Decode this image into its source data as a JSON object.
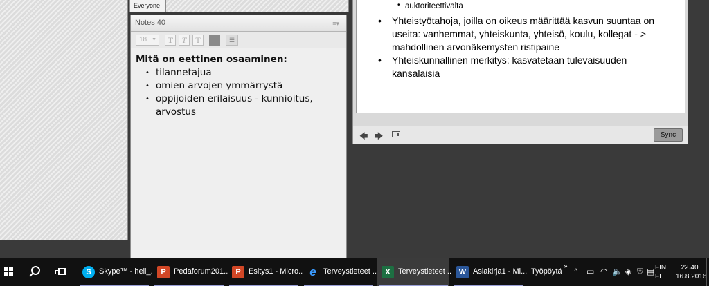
{
  "left_panel": {},
  "attendee_strip": {
    "tab_label": "Everyone"
  },
  "notes_pod": {
    "title": "Notes 40",
    "menu_icon": "≡▾",
    "toolbar": {
      "font_size": "18",
      "bold": "T",
      "italic": "T",
      "underline": "T",
      "list": "☰"
    },
    "heading": "Mitä on eettinen osaaminen:",
    "items": [
      "tilannetajua",
      "omien arvojen ymmärrystä",
      "oppijoiden erilaisuus - kunnioitus, arvostus"
    ]
  },
  "share_pod": {
    "sub_bullet": "auktoriteettivalta",
    "bullets": [
      "Yhteistyötahoja, joilla on oikeus määrittää kasvun suuntaa on useita:  vanhemmat, yhteiskunta, yhteisö, koulu, kollegat - > mahdollinen arvonäkemysten ristipaine",
      "Yhteiskunnallinen merkitys: kasvatetaan tulevaisuuden kansalaisia"
    ],
    "prev": "🡄",
    "next": "🡆",
    "sync_label": "Sync"
  },
  "taskbar": {
    "apps": [
      {
        "label": "Skype™ - heli_...",
        "icon": "S",
        "color": "#00aff0"
      },
      {
        "label": "Pedaforum201...",
        "icon": "P",
        "color": "#d24726"
      },
      {
        "label": "Esitys1 - Micro...",
        "icon": "P",
        "color": "#d24726"
      },
      {
        "label": "Terveystieteet ...",
        "icon": "e",
        "color": "#1e90ff"
      },
      {
        "label": "Terveystieteet ...",
        "icon": "X",
        "color": "#1d6f42"
      },
      {
        "label": "Asiakirja1 - Mi...",
        "icon": "W",
        "color": "#2b579a"
      }
    ],
    "desktop_label": "Työpöytä",
    "desktop_chevron": "»",
    "tray_icons": {
      "chevron": "^",
      "battery": "▭",
      "network": "◠",
      "volume": "🔈",
      "dropbox": "◈",
      "security": "⛨",
      "notifications": "▤"
    },
    "language": [
      "FIN",
      "FI"
    ],
    "time": "22.40",
    "date": "16.8.2016"
  }
}
